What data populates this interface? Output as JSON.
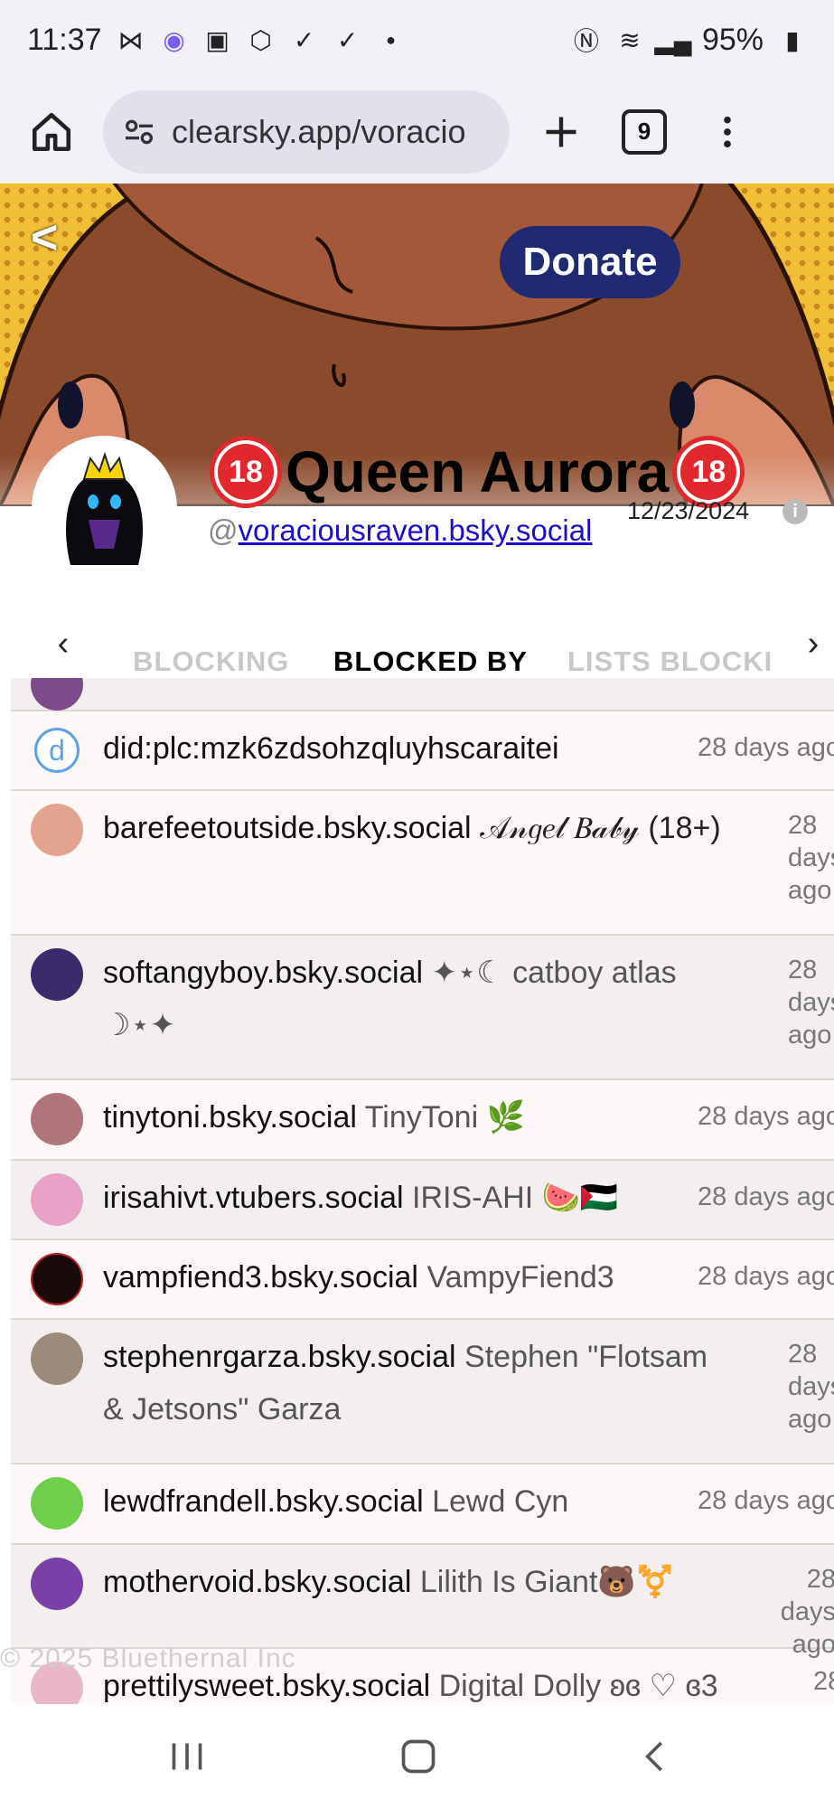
{
  "status": {
    "time": "11:37",
    "battery": "95%"
  },
  "browser": {
    "url": "clearsky.app/voracio",
    "tab_count": "9"
  },
  "profile": {
    "back_label": "<",
    "donate_label": "Donate",
    "display_name": "Queen Aurora",
    "badge_text": "18",
    "handle_prefix": "@",
    "handle": "voraciousraven.bsky.social",
    "date": "12/23/2024",
    "info_glyph": "i"
  },
  "tabs": {
    "prev": "‹",
    "next": "›",
    "blocking": "BLOCKING",
    "blocked_by": "BLOCKED BY",
    "lists_blocking": "LISTS BLOCKI"
  },
  "rows": [
    {
      "handle": "did:plc:mzk6zdsohzqluyhscaraitei",
      "name": "",
      "ago": "28 days ago"
    },
    {
      "handle": "barefeetoutside.bsky.social",
      "name": "𝒜𝓃𝑔𝑒𝓁 𝐵𝒶𝒷𝓎 (18+)",
      "ago": "28 days ago"
    },
    {
      "handle": "softangyboy.bsky.social",
      "name": "✦⋆☾ catboy atlas ☽⋆✦",
      "ago": "28 days ago"
    },
    {
      "handle": "tinytoni.bsky.social",
      "name": "TinyToni 🌿",
      "ago": "28 days ago"
    },
    {
      "handle": "irisahivt.vtubers.social",
      "name": "IRIS-AHI 🍉🇵🇸",
      "ago": "28 days ago"
    },
    {
      "handle": "vampfiend3.bsky.social",
      "name": "VampyFiend3",
      "ago": "28 days ago"
    },
    {
      "handle": "stephenrgarza.bsky.social",
      "name": "Stephen \"Flotsam & Jetsons\" Garza",
      "ago": "28 days ago"
    },
    {
      "handle": "lewdfrandell.bsky.social",
      "name": "Lewd Cyn",
      "ago": "28 days ago"
    },
    {
      "handle": "mothervoid.bsky.social",
      "name": "Lilith Is Giant🐻⚧️",
      "ago": "28 days ago"
    },
    {
      "handle": "prettilysweet.bsky.social",
      "name": "Digital Dolly ʚɞ ♡ ɞ3",
      "ago": "28"
    }
  ],
  "footer": {
    "watermark": "© 2025 Bluethernal Inc"
  },
  "colors": {
    "banner_yellow": "#f0bf36",
    "donate_bg": "#1f2a73",
    "link": "#1a0dcc",
    "badge_red": "#e0282e"
  }
}
